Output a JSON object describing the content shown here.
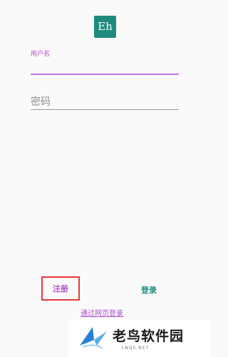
{
  "app": {
    "logo_text": "Eh",
    "logo_color": "#1e8b7e"
  },
  "form": {
    "username_label": "用户名",
    "username_value": "",
    "password_placeholder": "密码",
    "password_value": ""
  },
  "actions": {
    "register_label": "注册",
    "login_label": "登录",
    "web_login_label": "通过网页登录"
  },
  "colors": {
    "accent": "#b14fd0",
    "primary": "#1e8b7e",
    "highlight_box": "#e53935"
  },
  "watermark": {
    "text": "老鸟软件园",
    "sub": "LNQS.NET",
    "icon": "bird-logo-icon"
  }
}
